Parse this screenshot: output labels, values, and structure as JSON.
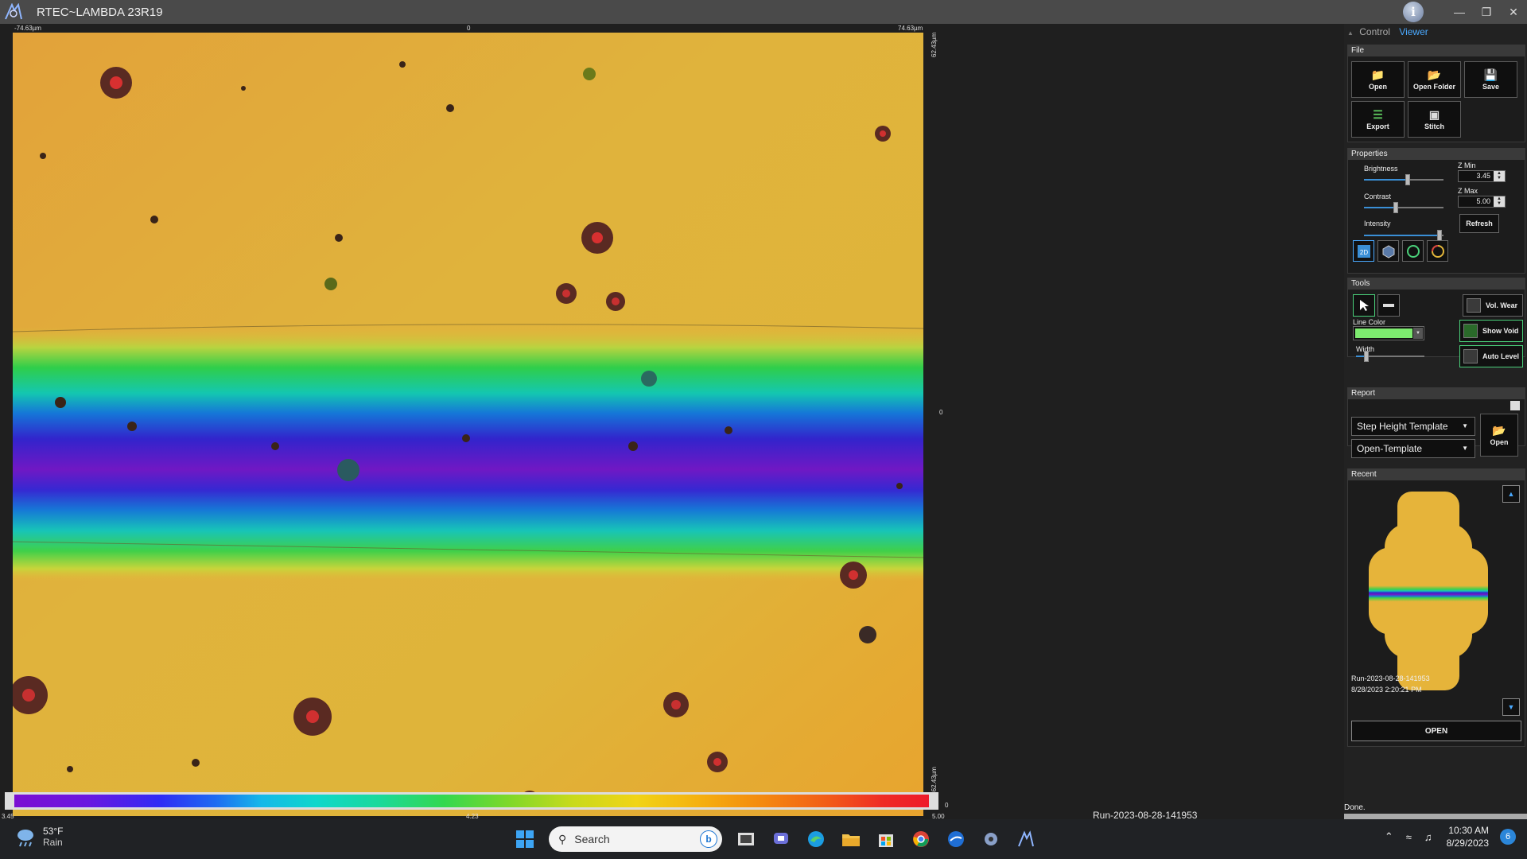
{
  "app": {
    "title": "RTEC~LAMBDA 23R19"
  },
  "viewer": {
    "x_left": "-74.63µm",
    "x_center": "0",
    "x_right": "74.63µm",
    "y_top": "62.43µm",
    "y_center": "0",
    "y_bottom": "-62.43µm",
    "colorbar_min": "3.45",
    "colorbar_mid": "4.23",
    "colorbar_max": "5.00",
    "colorbar_tail": "0",
    "file_label": "Run-2023-08-28-141953"
  },
  "panel": {
    "tabs": {
      "control": "Control",
      "viewer": "Viewer"
    },
    "file": {
      "header": "File",
      "open": "Open",
      "open_folder": "Open Folder",
      "save": "Save",
      "export": "Export",
      "stitch": "Stitch"
    },
    "properties": {
      "header": "Properties",
      "brightness": "Brightness",
      "contrast": "Contrast",
      "intensity": "Intensity",
      "brightness_level": 0.55,
      "contrast_level": 0.4,
      "intensity_level": 0.95,
      "zmin_label": "Z Min",
      "zmin_value": "3.45",
      "zmax_label": "Z Max",
      "zmax_value": "5.00",
      "refresh": "Refresh"
    },
    "tools": {
      "header": "Tools",
      "line_color_label": "Line Color",
      "line_color": "#7dea6f",
      "width_label": "Width",
      "width_level": 0.15,
      "vol_wear": "Vol. Wear",
      "show_void": "Show Void",
      "auto_level": "Auto Level"
    },
    "report": {
      "header": "Report",
      "template": "Step Height Template",
      "open_template": "Open-Template",
      "open": "Open"
    },
    "recent": {
      "header": "Recent",
      "name": "Run-2023-08-28-141953",
      "date": "8/28/2023 2:20:21 PM",
      "open": "OPEN"
    },
    "status": "Done."
  },
  "taskbar": {
    "temp": "53°F",
    "weather": "Rain",
    "search_placeholder": "Search",
    "time": "10:30 AM",
    "date": "8/29/2023",
    "notifications": "6"
  },
  "colors": {
    "accent": "#4aa9ff",
    "surface_orange": "#e8a431",
    "surface_yellow": "#e2b73a"
  }
}
